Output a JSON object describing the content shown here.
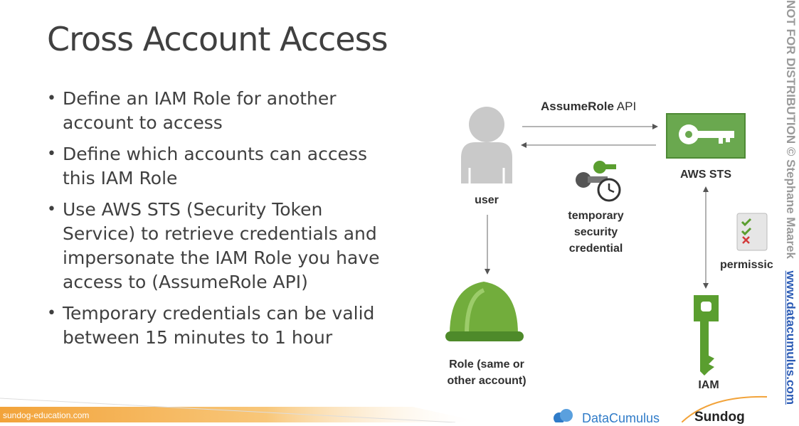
{
  "slide": {
    "title": "Cross Account Access",
    "bullets": [
      "Define an IAM Role for another account to access",
      "Define which accounts can access this IAM Role",
      "Use AWS STS (Security Token Service) to retrieve credentials and impersonate the IAM Role you have access to (AssumeRole API)",
      "Temporary credentials can be valid between 15 minutes to 1 hour"
    ]
  },
  "diagram": {
    "api_bold": "AssumeRole",
    "api_rest": " API",
    "user_label": "user",
    "sts_label": "AWS STS",
    "temp_cred_label": "temporary security credential",
    "permissions_label": "permissic",
    "role_label": "Role (same or other account)",
    "iam_label": "IAM",
    "colors": {
      "aws_green": "#6aa84f",
      "key_green": "#5a9e2f",
      "role_green": "#72ad3c"
    }
  },
  "footer": {
    "url": "sundog-education.com",
    "logo_left": "DataCumulus",
    "logo_right": "Sundog",
    "watermark": "NOT FOR DISTRIBUTION © Stephane Maarek",
    "watermark_url": "www.datacumulus.com"
  }
}
